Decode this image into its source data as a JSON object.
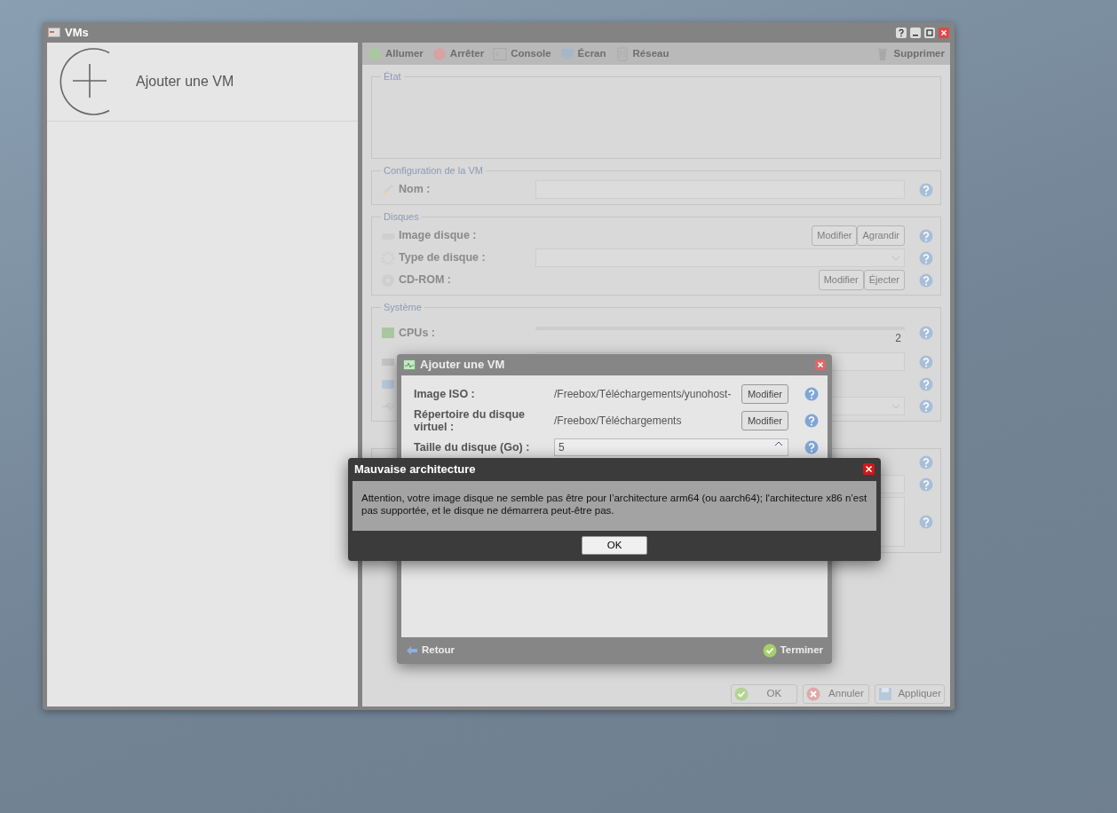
{
  "window": {
    "title": "VMs"
  },
  "sidebar": {
    "items": [
      {
        "label": "Ajouter une VM"
      }
    ]
  },
  "toolbar": {
    "buttons": [
      {
        "label": "Allumer",
        "kind": "power",
        "disabled": true
      },
      {
        "label": "Arrêter",
        "kind": "stop",
        "disabled": true
      },
      {
        "label": "Console",
        "kind": "console",
        "disabled": true
      },
      {
        "label": "Écran",
        "kind": "screen",
        "disabled": true
      },
      {
        "label": "Réseau",
        "kind": "network",
        "disabled": true
      },
      {
        "label": "Supprimer",
        "kind": "trash",
        "disabled": true
      }
    ]
  },
  "sections": [
    {
      "legend": "État",
      "kind": "status"
    },
    {
      "legend": "Configuration de la VM",
      "rows": [
        {
          "kind": "text",
          "label": "Nom :"
        }
      ]
    },
    {
      "legend": "Disques",
      "rows": [
        {
          "kind": "buttons",
          "label": "Image disque :",
          "buttons": [
            "Modifier",
            "Agrandir"
          ]
        },
        {
          "kind": "select",
          "label": "Type de disque :"
        },
        {
          "kind": "buttons",
          "label": "CD-ROM :",
          "buttons": [
            "Modifier",
            "Éjecter"
          ]
        }
      ]
    },
    {
      "legend": "Système",
      "rows": [
        {
          "kind": "slider",
          "label": "CPUs :",
          "reading": "2"
        },
        {
          "kind": "spin"
        },
        {
          "kind": "blank"
        },
        {
          "kind": "select"
        }
      ]
    },
    {
      "kind": "hidden",
      "rows": [
        {
          "kind": "blank"
        },
        {
          "kind": "text"
        },
        {
          "kind": "area"
        }
      ]
    }
  ],
  "footer": {
    "buttons": [
      {
        "label": "OK",
        "kind": "ok",
        "disabled": true
      },
      {
        "label": "Annuler",
        "kind": "cancel",
        "disabled": true
      },
      {
        "label": "Appliquer",
        "kind": "apply",
        "disabled": true
      }
    ]
  },
  "dialog": {
    "title": "Ajouter une VM",
    "rows": [
      {
        "kind": "path",
        "label": "Image ISO :",
        "value": "/Freebox/Téléchargements/yunohost-",
        "button": "Modifier"
      },
      {
        "kind": "path",
        "label": "Répertoire du disque virtuel :",
        "value": "/Freebox/Téléchargements",
        "button": "Modifier"
      },
      {
        "kind": "number",
        "label": "Taille du disque (Go) :",
        "value": "5"
      }
    ],
    "back": "Retour",
    "finish": "Terminer"
  },
  "alert": {
    "title": "Mauvaise architecture",
    "message": "Attention, votre image disque ne semble pas être pour l’architecture arm64 (ou aarch64); l'architecture x86 n’est pas supportée, et le disque ne démarrera peut-être pas.",
    "button": "OK"
  }
}
